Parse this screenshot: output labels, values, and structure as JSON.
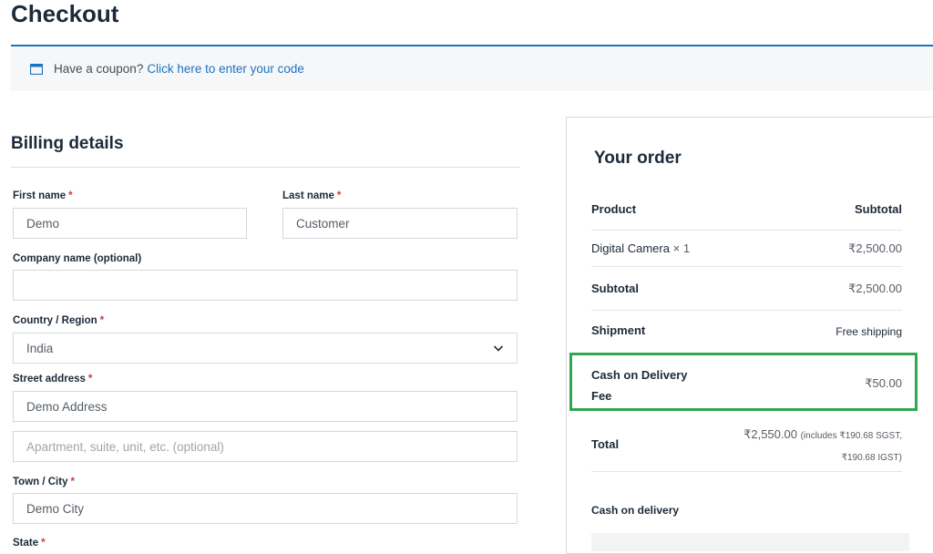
{
  "page": {
    "title": "Checkout"
  },
  "coupon": {
    "text": "Have a coupon?",
    "link": "Click here to enter your code",
    "icon": "coupon-icon"
  },
  "billing": {
    "title": "Billing details",
    "required_mark": "*",
    "first_name": {
      "label": "First name",
      "value": "Demo"
    },
    "last_name": {
      "label": "Last name",
      "value": "Customer"
    },
    "company": {
      "label": "Company name (optional)",
      "value": ""
    },
    "country": {
      "label": "Country / Region",
      "value": "India"
    },
    "street": {
      "label": "Street address",
      "value": "Demo Address",
      "placeholder2": "Apartment, suite, unit, etc. (optional)"
    },
    "city": {
      "label": "Town / City",
      "value": "Demo City"
    },
    "state": {
      "label": "State"
    }
  },
  "order": {
    "title": "Your order",
    "headers": {
      "product": "Product",
      "subtotal": "Subtotal"
    },
    "item": {
      "name": "Digital Camera",
      "qty": "× 1",
      "price": "₹2,500.00"
    },
    "subtotal": {
      "label": "Subtotal",
      "value": "₹2,500.00"
    },
    "shipment": {
      "label": "Shipment",
      "value": "Free shipping"
    },
    "fee": {
      "label_line1": "Cash on Delivery",
      "label_line2": "Fee",
      "value": "₹50.00"
    },
    "total": {
      "label": "Total",
      "value": "₹2,550.00",
      "tax_line1": "(includes ₹190.68 SGST,",
      "tax_line2": "₹190.68 IGST)"
    },
    "payment_method": "Cash on delivery"
  },
  "colors": {
    "accent": "#1e73be",
    "required": "#d63638",
    "highlight": "#2fa84f"
  }
}
